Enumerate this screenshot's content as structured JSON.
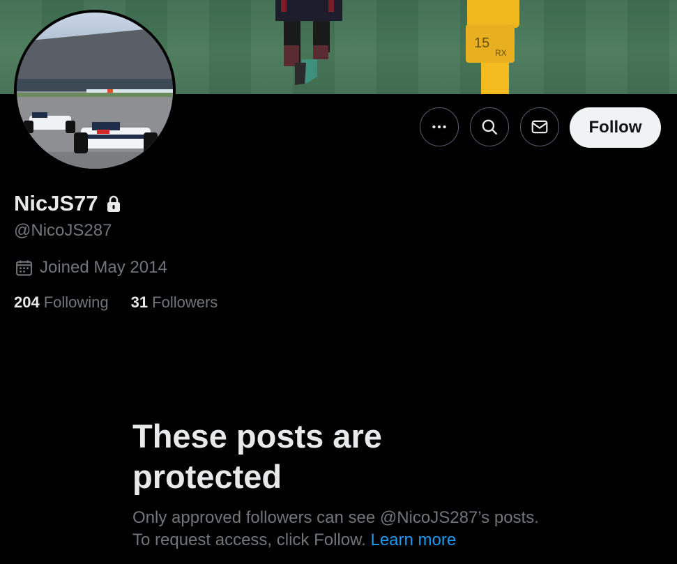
{
  "profile": {
    "display_name": "NicJS77",
    "handle": "@NicoJS287",
    "joined": "Joined May 2014",
    "following_count": "204",
    "following_label": "Following",
    "followers_count": "31",
    "followers_label": "Followers"
  },
  "actions": {
    "more_icon": "more-dots-icon",
    "search_icon": "search-icon",
    "message_icon": "envelope-icon",
    "follow_label": "Follow"
  },
  "protected": {
    "title": "These posts are protected",
    "description": "Only approved followers can see @NicoJS287’s posts. To request access, click Follow.",
    "learn_more": "Learn more"
  },
  "colors": {
    "background": "#000000",
    "primary_text": "#e7e9ea",
    "secondary_text": "#71767b",
    "link": "#1d9bf0",
    "follow_button_bg": "#eff3f4",
    "border": "#536471"
  }
}
